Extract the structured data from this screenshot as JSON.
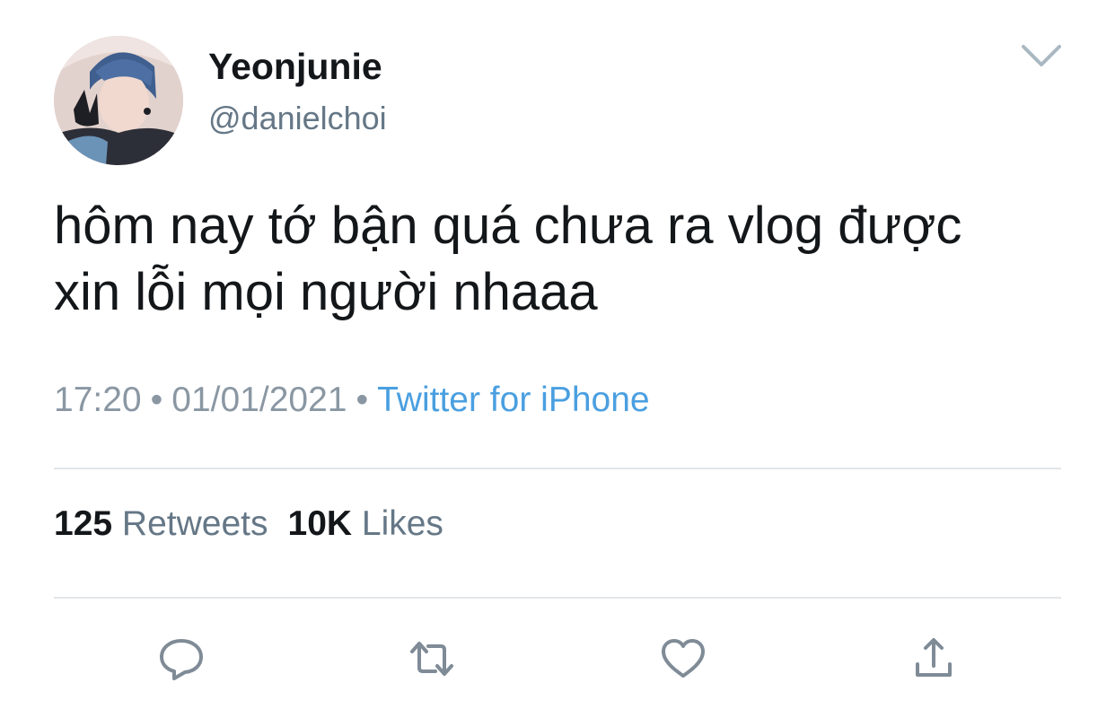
{
  "user": {
    "display_name": "Yeonjunie",
    "handle": "@danielchoi"
  },
  "tweet": {
    "lines": [
      "hôm nay tớ bận quá chưa ra vlog được",
      "xin lỗi mọi người nhaaa"
    ],
    "time": "17:20",
    "date": "01/01/2021",
    "separator": "•",
    "source": "Twitter for iPhone"
  },
  "stats": {
    "retweets_count": "125",
    "retweets_label": "Retweets",
    "likes_count": "10K",
    "likes_label": "Likes"
  },
  "icons": {
    "menu": "chevron-down-icon",
    "reply": "reply-icon",
    "retweet": "retweet-icon",
    "like": "heart-icon",
    "share": "share-icon"
  },
  "colors": {
    "text": "#14171a",
    "secondary": "#657786",
    "link": "#4a9fe0",
    "icon": "#7f8b96",
    "divider": "#e3e6e9"
  }
}
